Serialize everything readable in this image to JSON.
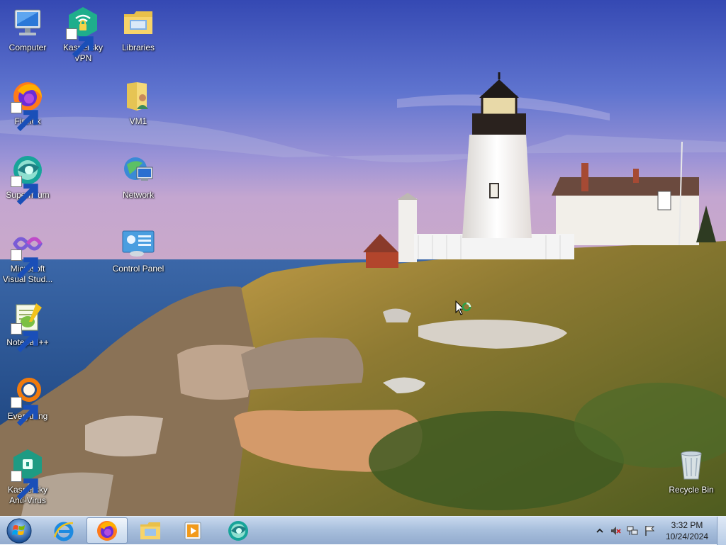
{
  "desktop": {
    "icons": [
      {
        "label": "Computer",
        "icon": "computer-icon",
        "shortcut": false
      },
      {
        "label": "Kaspersky VPN",
        "icon": "kaspersky-vpn-icon",
        "shortcut": true
      },
      {
        "label": "Libraries",
        "icon": "libraries-folder-icon",
        "shortcut": false
      },
      {
        "label": "Firefox",
        "icon": "firefox-icon",
        "shortcut": true
      },
      {
        "label": "VM1",
        "icon": "user-folder-icon",
        "shortcut": false
      },
      {
        "label": "Supermium",
        "icon": "supermium-icon",
        "shortcut": true
      },
      {
        "label": "Network",
        "icon": "network-icon",
        "shortcut": false
      },
      {
        "label": "Microsoft Visual Stud...",
        "icon": "visual-studio-icon",
        "shortcut": true
      },
      {
        "label": "Control Panel",
        "icon": "control-panel-icon",
        "shortcut": false
      },
      {
        "label": "Notepad++",
        "icon": "notepad-plus-plus-icon",
        "shortcut": true
      },
      {
        "label": "Everything",
        "icon": "everything-search-icon",
        "shortcut": true
      },
      {
        "label": "Kaspersky Anti-Virus",
        "icon": "kaspersky-antivirus-icon",
        "shortcut": true
      },
      {
        "label": "Recycle Bin",
        "icon": "recycle-bin-icon",
        "shortcut": false
      }
    ],
    "wallpaper": "lighthouse-coast"
  },
  "taskbar": {
    "start_icon": "windows-start-orb-icon",
    "pinned": [
      {
        "name": "internet-explorer",
        "icon": "internet-explorer-icon",
        "active": false
      },
      {
        "name": "firefox",
        "icon": "firefox-icon",
        "active": true
      },
      {
        "name": "file-explorer",
        "icon": "file-explorer-icon",
        "active": false
      },
      {
        "name": "media-player",
        "icon": "media-player-icon",
        "active": false
      },
      {
        "name": "supermium",
        "icon": "supermium-icon",
        "active": false
      }
    ],
    "tray": {
      "icons": [
        "show-hidden-icons-chevron-icon",
        "volume-muted-icon",
        "network-icon",
        "action-center-flag-icon"
      ],
      "time": "3:32 PM",
      "date": "10/24/2024"
    }
  },
  "colors": {
    "taskbar": "#a9c0dd",
    "accent": "#3a6ea5"
  }
}
